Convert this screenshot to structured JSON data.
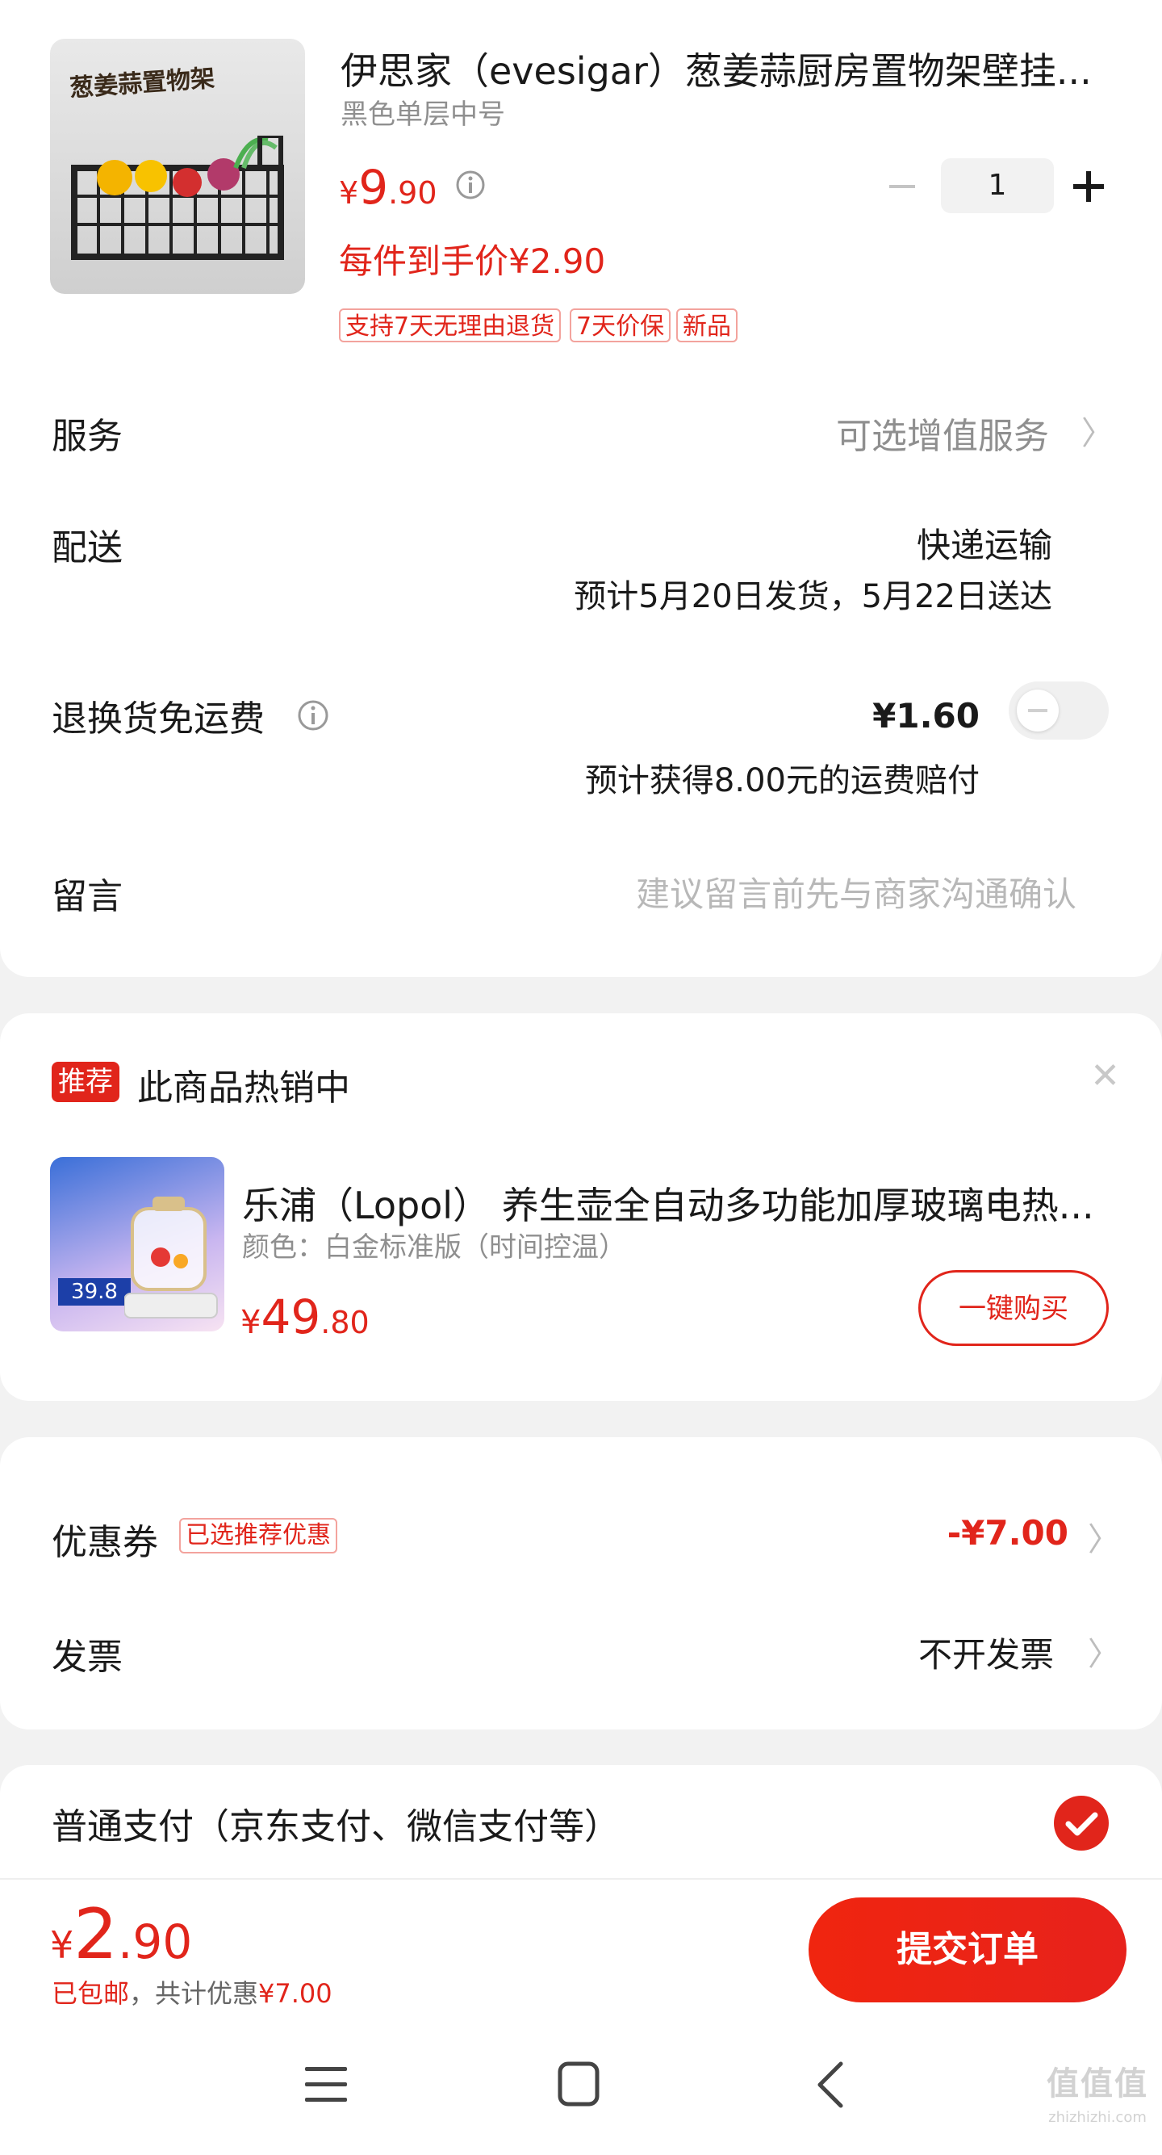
{
  "product": {
    "image_caption": "葱姜蒜置物架",
    "title": "伊思家（evesigar）葱姜蒜厨房置物架壁挂...",
    "variant": "黑色单层中号",
    "price_symbol": "¥",
    "price_int": "9",
    "price_dec": ".90",
    "unit_price": "每件到手价¥2.90",
    "quantity": "1",
    "tags": [
      "支持7天无理由退货",
      "7天价保",
      "新品"
    ]
  },
  "rows": {
    "service_label": "服务",
    "service_value": "可选增值服务",
    "delivery_label": "配送",
    "delivery_method": "快递运输",
    "delivery_estimate": "预计5月20日发货，5月22日送达",
    "return_label": "退换货免运费",
    "return_price": "¥1.60",
    "return_note": "预计获得8.00元的运费赔付",
    "message_label": "留言",
    "message_placeholder": "建议留言前先与商家沟通确认"
  },
  "recommend": {
    "badge": "推荐",
    "heading": "此商品热销中",
    "title": "乐浦（Lopol） 养生壶全自动多功能加厚玻璃电热...",
    "variant": "颜色：白金标准版（时间控温）",
    "price_symbol": "¥",
    "price_int": "49",
    "price_dec": ".80",
    "button": "一键购买",
    "thumb_price": "39.8"
  },
  "discount": {
    "coupon_label": "优惠券",
    "coupon_tag": "已选推荐优惠",
    "coupon_value": "-¥7.00",
    "invoice_label": "发票",
    "invoice_value": "不开发票"
  },
  "payment": {
    "label": "普通支付（京东支付、微信支付等）"
  },
  "footer": {
    "price_symbol": "¥",
    "price_int": "2",
    "price_dec": ".90",
    "shipping": "已包邮",
    "savings_prefix": "，共计优惠",
    "savings_value": "¥7.00",
    "submit": "提交订单"
  },
  "watermark": {
    "text": "值值值",
    "domain": "zhizhizhi.com"
  },
  "colors": {
    "accent": "#e1251b",
    "gradient_start": "#f0250f",
    "gradient_end": "#e7221c"
  },
  "icons": [
    "info-icon",
    "minus-icon",
    "plus-icon",
    "chevron-right-icon",
    "toggle-off-icon",
    "close-icon",
    "check-circle-icon",
    "menu-icon",
    "home-icon",
    "back-icon"
  ]
}
